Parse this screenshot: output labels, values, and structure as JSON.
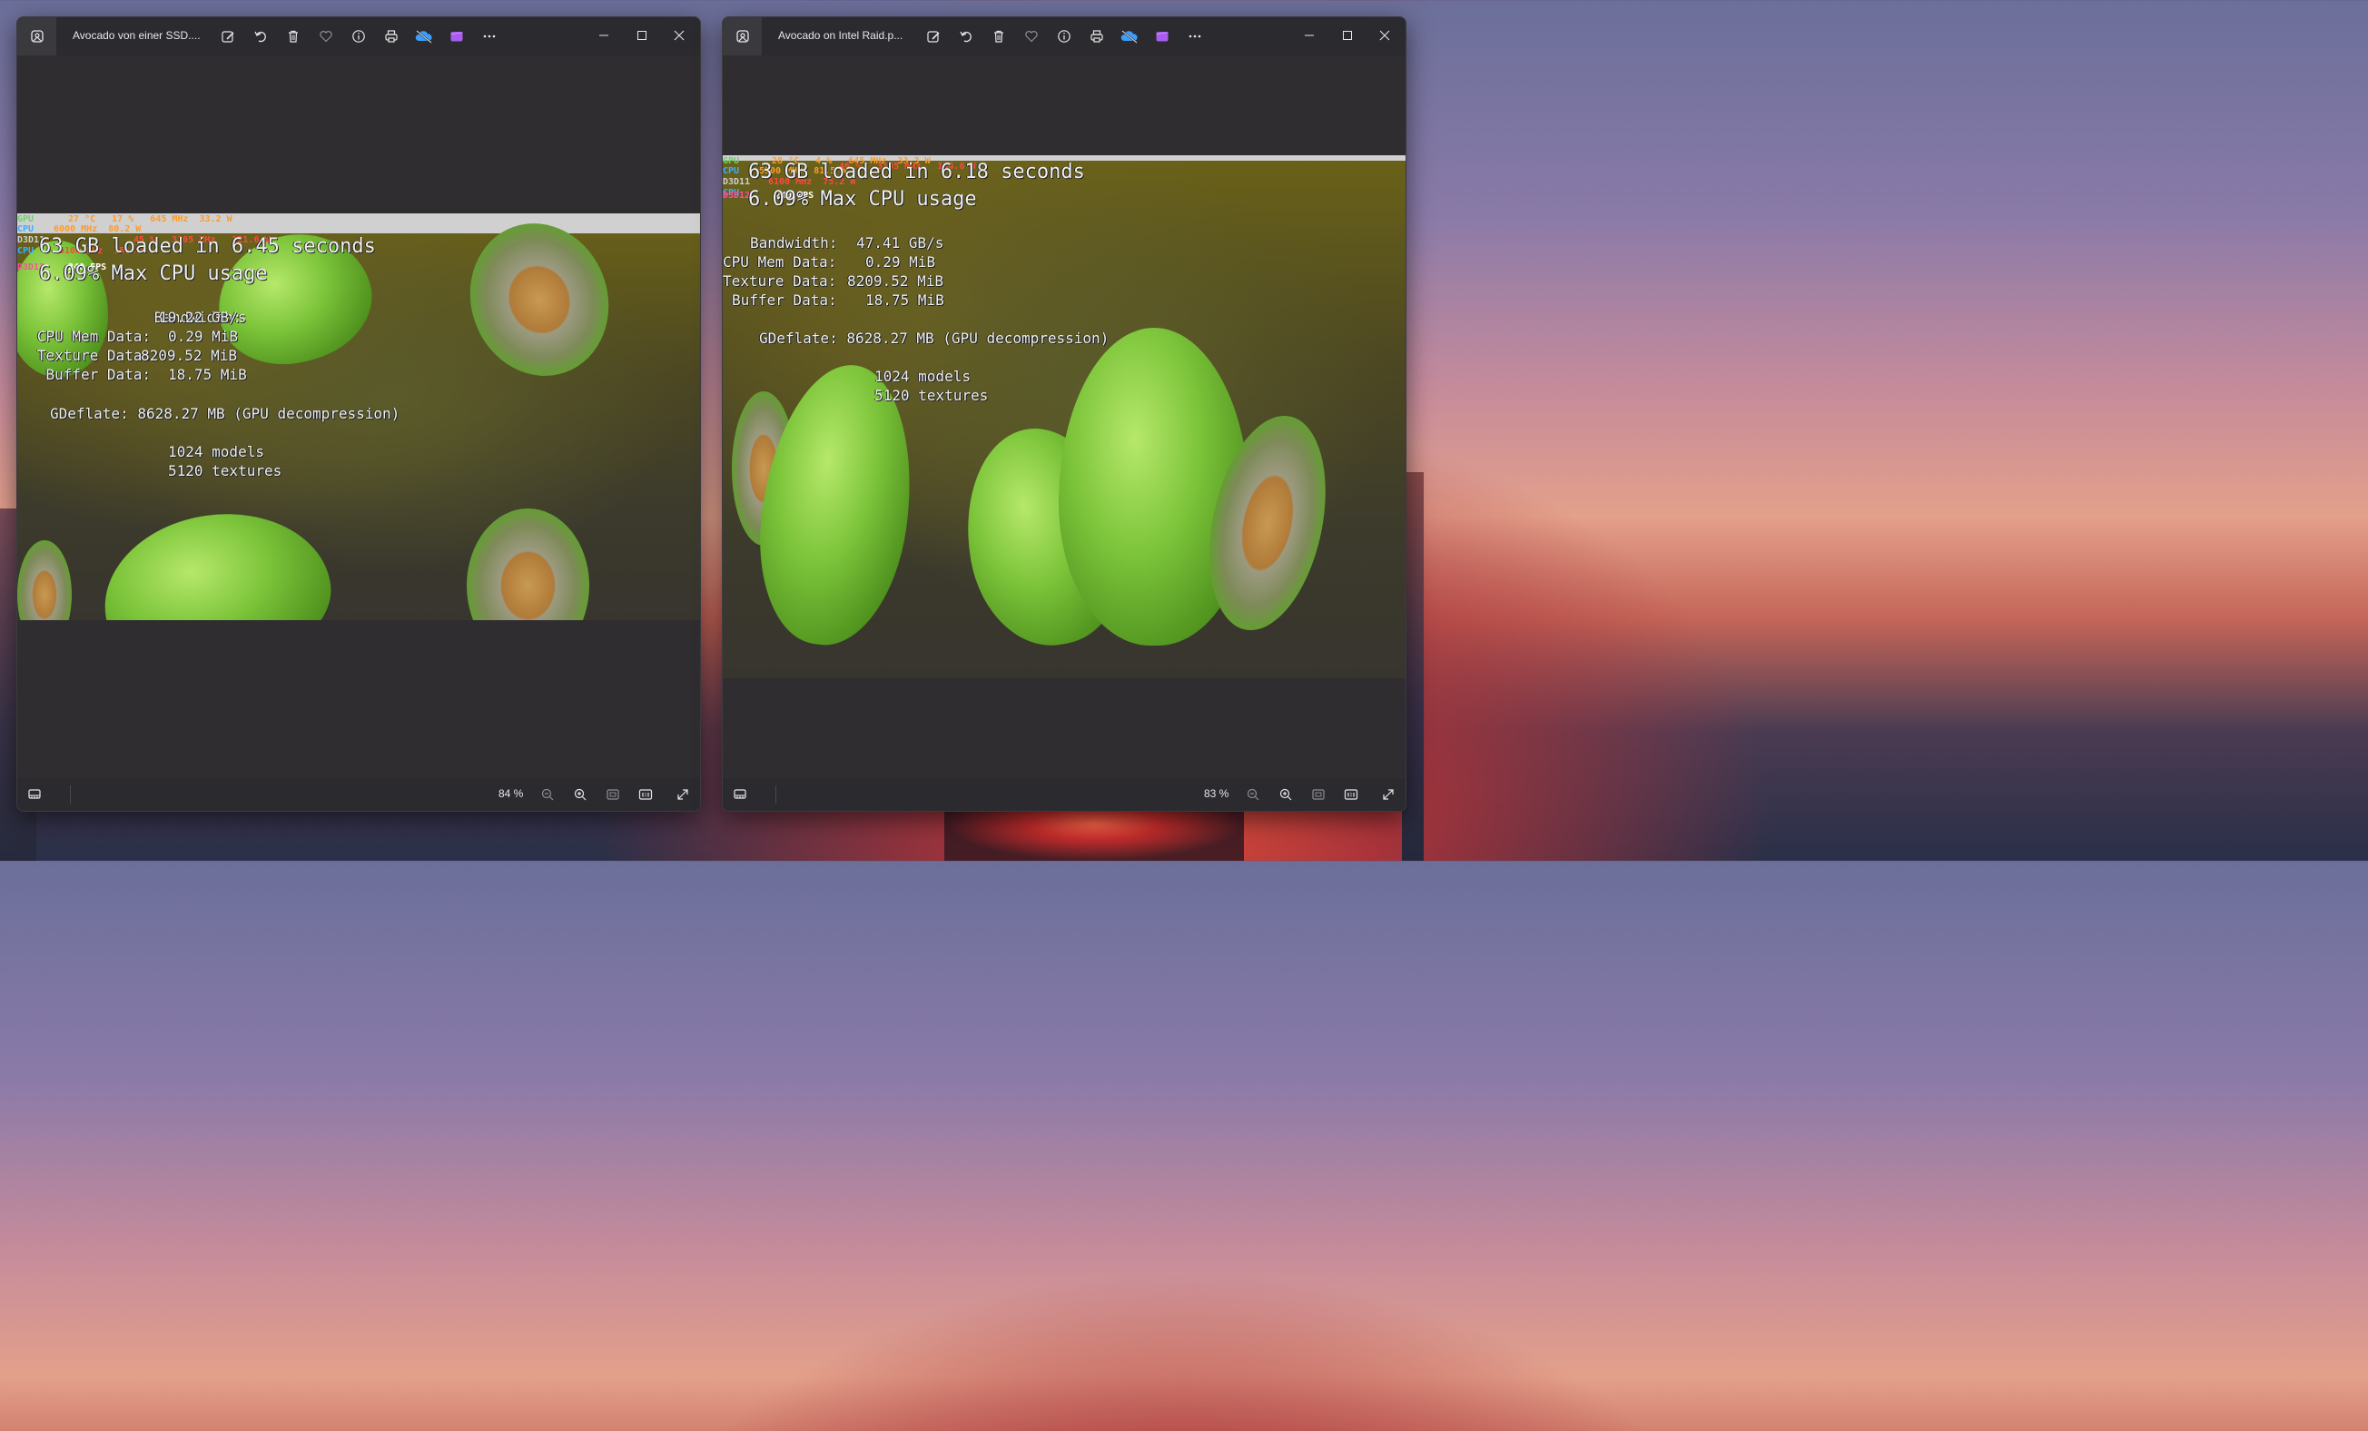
{
  "windows": [
    {
      "title": "Avocado von einer SSD....",
      "zoom": "84 %",
      "overlay": {
        "loaded": "63 GB loaded in 6.45 seconds",
        "cpu_usage": "6.09% Max CPU usage",
        "bandwidth_label": "Bandwidth:",
        "bandwidth_value": "19.22 GB/s",
        "cpu_mem_label": "CPU Mem Data:",
        "cpu_mem_value": "0.29 MiB",
        "texture_label": "Texture Data:",
        "texture_value": "8209.52 MiB",
        "buffer_label": "Buffer Data:",
        "buffer_value": "18.75 MiB",
        "gdeflate": "GDeflate: 8628.27 MB (GPU decompression)",
        "models": "1024 models",
        "textures": "5120 textures"
      },
      "osd": {
        "gpu": "GPU",
        "gpu_vals": "27 °C   17 %   645 MHz  33.2 W",
        "cpu": "CPU",
        "cpu_vals": "6000 MHz  80.2 W",
        "d3d11": "D3D11",
        "d3d11_vals": "45 %   3105 MHz   131.6 W",
        "cpu2": "CPU",
        "cpu2_vals": "6100 MHz  75.3 W",
        "d3d12": "D3D12",
        "fps": "240 FPS"
      }
    },
    {
      "title": "Avocado on Intel Raid.p...",
      "zoom": "83 %",
      "overlay": {
        "loaded": "63 GB loaded in 6.18 seconds",
        "cpu_usage": "6.09% Max CPU usage",
        "bandwidth_label": "Bandwidth:",
        "bandwidth_value": "47.41 GB/s",
        "cpu_mem_label": "CPU Mem Data:",
        "cpu_mem_value": "0.29 MiB",
        "texture_label": "Texture Data:",
        "texture_value": "8209.52 MiB",
        "buffer_label": "Buffer Data:",
        "buffer_value": "18.75 MiB",
        "gdeflate": "GDeflate: 8628.27 MB (GPU decompression)",
        "models": "1024 models",
        "textures": "5120 textures"
      },
      "osd": {
        "gpu": "GPU",
        "gpu_vals": "28 °C   4 %   645 MHz  33.3 W",
        "cpu": "CPU",
        "cpu_vals": "5900 MHz  81.5 W",
        "d3d11": "D3D11",
        "d3d11_vals": "46 %   3105 MHz   134.6 W",
        "cpu2": "CPU",
        "cpu2_vals": "6100 MHz  75.2 W",
        "d3d12": "D3D12",
        "fps": "240 FPS"
      }
    }
  ],
  "icons": {
    "app": "photos-app-icon",
    "toolbar": [
      "edit-image-icon",
      "rotate-icon",
      "delete-icon",
      "favorite-icon",
      "info-icon",
      "print-icon",
      "onedrive-icon",
      "clipchamp-icon",
      "more-icon"
    ],
    "window_controls": [
      "minimize-icon",
      "maximize-icon",
      "close-icon"
    ],
    "statusbar": [
      "filmstrip-icon",
      "zoom-out-icon",
      "zoom-in-icon",
      "fit-to-window-icon",
      "actual-size-icon",
      "fullscreen-icon"
    ]
  },
  "colors": {
    "window_bg": "#2b2a2e",
    "text": "#e6e6e6",
    "onedrive": "#3aa0ff",
    "clipchamp": "#a85cf0",
    "osd_gpu": "#6fd06f",
    "osd_cpu": "#3ab0ff",
    "osd_temp": "#ff9a2a",
    "osd_power": "#ff4a3a",
    "osd_d3d12": "#ff4fa0"
  }
}
